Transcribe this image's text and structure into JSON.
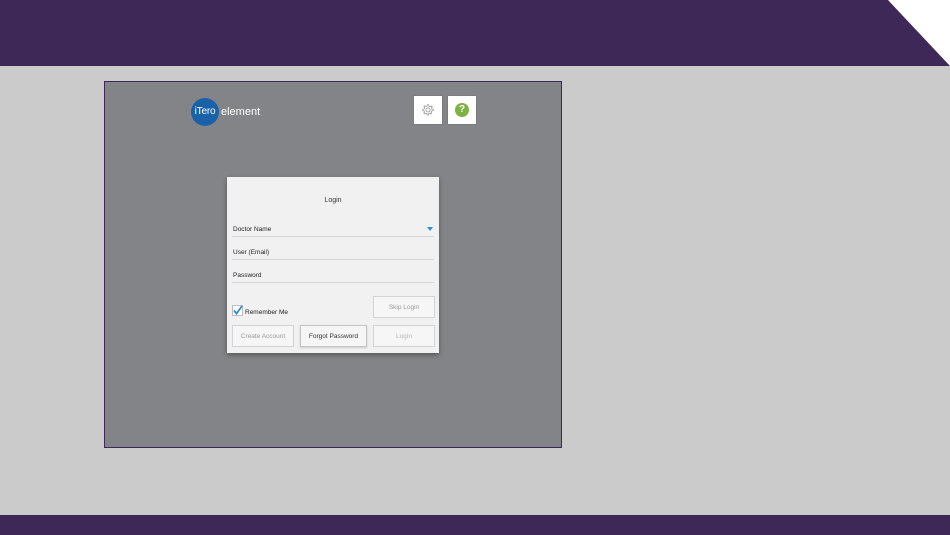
{
  "app": {
    "logo_badge": "iTero",
    "logo_word": "element",
    "logo_dot": "."
  },
  "toolbar": {
    "settings_icon": "gear-icon",
    "help_icon": "question-circle-icon",
    "help_glyph": "?"
  },
  "login": {
    "title": "Login",
    "doctor_label": "Doctor Name",
    "user_label": "User (Email)",
    "password_label": "Password",
    "remember_label": "Remember Me",
    "remember_checked": true,
    "skip_label": "Skip Login",
    "create_label": "Create Account",
    "forgot_label": "Forgot Password",
    "login_label": "Login"
  },
  "colors": {
    "brand_purple": "#3e2857",
    "screen_gray": "#838487",
    "page_gray": "#cbcbcb",
    "logo_blue": "#1a62a8",
    "help_green": "#7cb342",
    "accent_blue": "#2a8fd8"
  }
}
